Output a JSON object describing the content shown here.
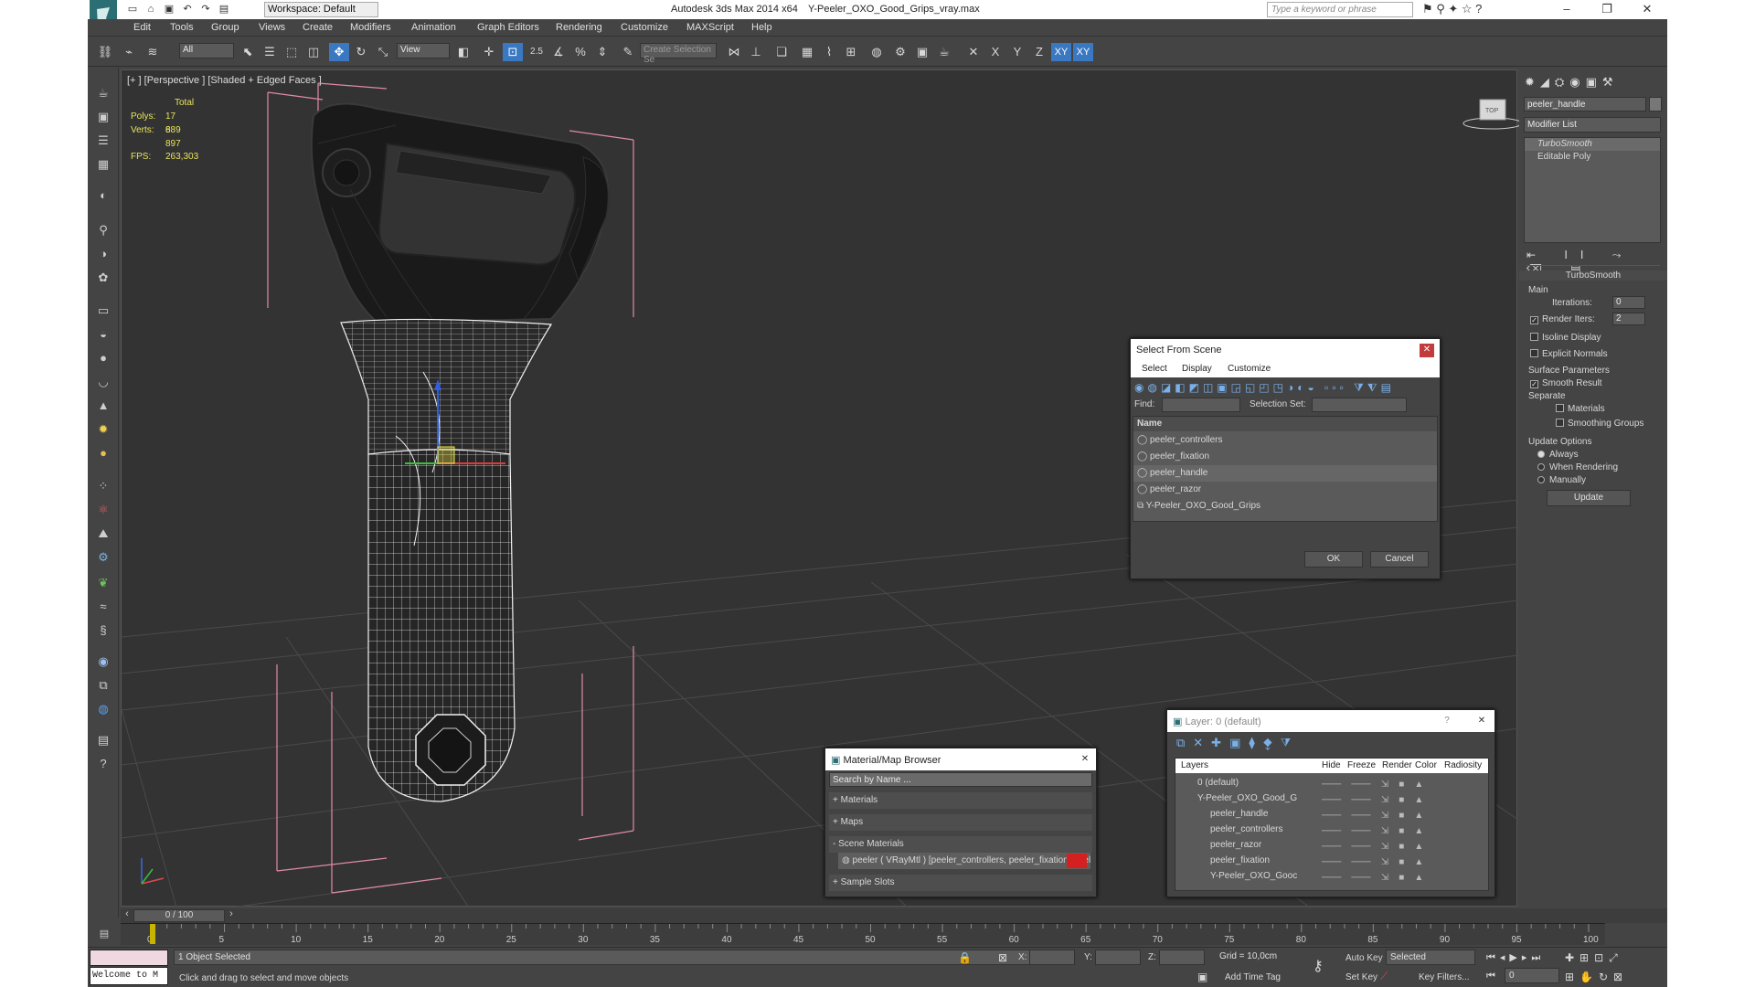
{
  "titlebar": {
    "workspace": "Workspace: Default",
    "app": "Autodesk 3ds Max  2014 x64",
    "file": "Y-Peeler_OXO_Good_Grips_vray.max",
    "search_placeholder": "Type a keyword or phrase"
  },
  "menu": [
    "Edit",
    "Tools",
    "Group",
    "Views",
    "Create",
    "Modifiers",
    "Animation",
    "Graph Editors",
    "Rendering",
    "Customize",
    "MAXScript",
    "Help"
  ],
  "toolbar": {
    "filter": "All",
    "refcoord": "View",
    "selset": "Create Selection Se",
    "axis_x": "X",
    "axis_y": "Y",
    "axis_z": "Z",
    "axis_xy": "XY",
    "axis_xy2": "XY",
    "snap_25": "2.5"
  },
  "viewport": {
    "label": "[+ ] [Perspective ] [Shaded + Edged Faces ]",
    "stats_total": "Total",
    "polys_label": "Polys:",
    "polys": "17 689",
    "verts_label": "Verts:",
    "verts": "8 897",
    "fps_label": "FPS:",
    "fps": "263,303"
  },
  "rightpanel": {
    "object_name": "peeler_handle",
    "modifier_list": "Modifier List",
    "stack": [
      "TurboSmooth",
      "Editable Poly"
    ],
    "rollout_title": "TurboSmooth",
    "main": "Main",
    "iterations_label": "Iterations:",
    "iterations": "0",
    "render_iters_label": "Render Iters:",
    "render_iters": "2",
    "isoline": "Isoline Display",
    "explicit": "Explicit Normals",
    "surface": "Surface Parameters",
    "smooth_result": "Smooth Result",
    "separate": "Separate",
    "materials": "Materials",
    "smoothing_groups": "Smoothing Groups",
    "update_options": "Update Options",
    "always": "Always",
    "when_rendering": "When Rendering",
    "manually": "Manually",
    "update": "Update"
  },
  "select_dialog": {
    "title": "Select From Scene",
    "menus": [
      "Select",
      "Display",
      "Customize"
    ],
    "find_label": "Find:",
    "selset_label": "Selection Set:",
    "col_name": "Name",
    "items": [
      "peeler_controllers",
      "peeler_fixation",
      "peeler_handle",
      "peeler_razor",
      "Y-Peeler_OXO_Good_Grips"
    ],
    "ok": "OK",
    "cancel": "Cancel"
  },
  "material_browser": {
    "title": "Material/Map Browser",
    "search": "Search by Name ...",
    "materials": "+ Materials",
    "maps": "+ Maps",
    "scene_materials": "- Scene Materials",
    "entry": "peeler  ( VRayMtl )  [peeler_controllers, peeler_fixation, peeler_h...",
    "sample_slots": "+ Sample Slots"
  },
  "layer_dialog": {
    "title": "Layer: 0 (default)",
    "help": "?",
    "cols": [
      "Layers",
      "Hide",
      "Freeze",
      "Render",
      "Color",
      "Radiosity"
    ],
    "rows": [
      "0 (default)",
      "Y-Peeler_OXO_Good_G",
      "peeler_handle",
      "peeler_controllers",
      "peeler_razor",
      "peeler_fixation",
      "Y-Peeler_OXO_Gooc"
    ]
  },
  "timeline": {
    "frame": "0 / 100",
    "ticks": [
      "0",
      "5",
      "10",
      "15",
      "20",
      "25",
      "30",
      "35",
      "40",
      "45",
      "50",
      "55",
      "60",
      "65",
      "70",
      "75",
      "80",
      "85",
      "90",
      "95",
      "100"
    ]
  },
  "status": {
    "maxscript": "Welcome to M",
    "selected": "1 Object Selected",
    "prompt": "Click and drag to select and move objects",
    "x_label": "X:",
    "y_label": "Y:",
    "z_label": "Z:",
    "grid": "Grid = 10,0cm",
    "add_time_tag": "Add Time Tag",
    "auto_key": "Auto Key",
    "set_key": "Set Key",
    "selected_dd": "Selected",
    "key_filters": "Key Filters...",
    "frame_field": "0"
  },
  "colors": {
    "accent": "#3a78c2",
    "viewport_bg": "#333333",
    "panel": "#444444",
    "stats": "#e8e45a"
  }
}
